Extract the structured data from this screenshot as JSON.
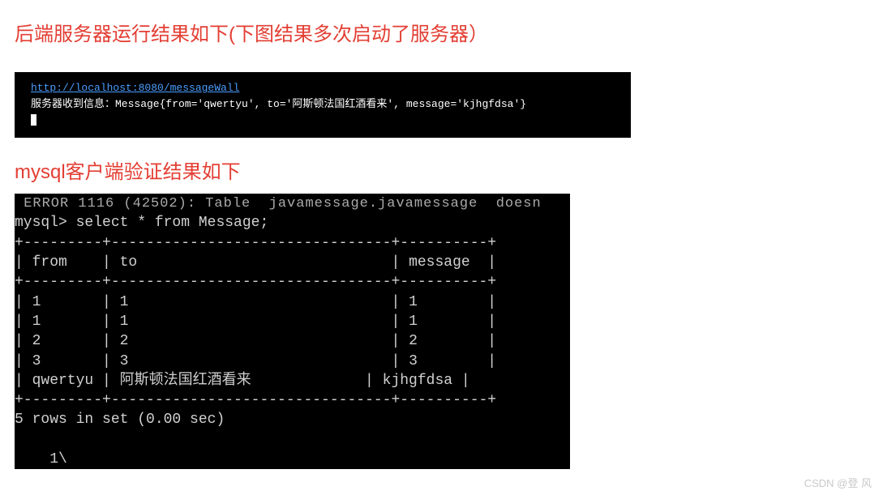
{
  "heading1": "后端服务器运行结果如下(下图结果多次启动了服务器）",
  "terminal_server": {
    "url": "http://localhost:8080/messageWall",
    "log_line": "服务器收到信息：Message{from='qwertyu', to='阿斯顿法国红酒看来', message='kjhgfdsa'}"
  },
  "heading2": "mysql客户端验证结果如下",
  "mysql_terminal": {
    "partial_top": " ERROR 1116 (42502): Table  javamessage.javamessage  doesn ",
    "prompt": "mysql> select * from Message;",
    "border_top": "+---------+--------------------------------+----------+",
    "header": "| from    | to                             | message  |",
    "border_mid": "+---------+--------------------------------+----------+",
    "rows": [
      "| 1       | 1                              | 1        |",
      "| 1       | 1                              | 1        |",
      "| 2       | 2                              | 2        |",
      "| 3       | 3                              | 3        |",
      "| qwertyu | 阿斯顿法国红酒看来             | kjhgfdsa |"
    ],
    "border_bot": "+---------+--------------------------------+----------+",
    "result": "5 rows in set (0.00 sec)",
    "tail": "    1\\"
  },
  "watermark": "CSDN @登 风"
}
